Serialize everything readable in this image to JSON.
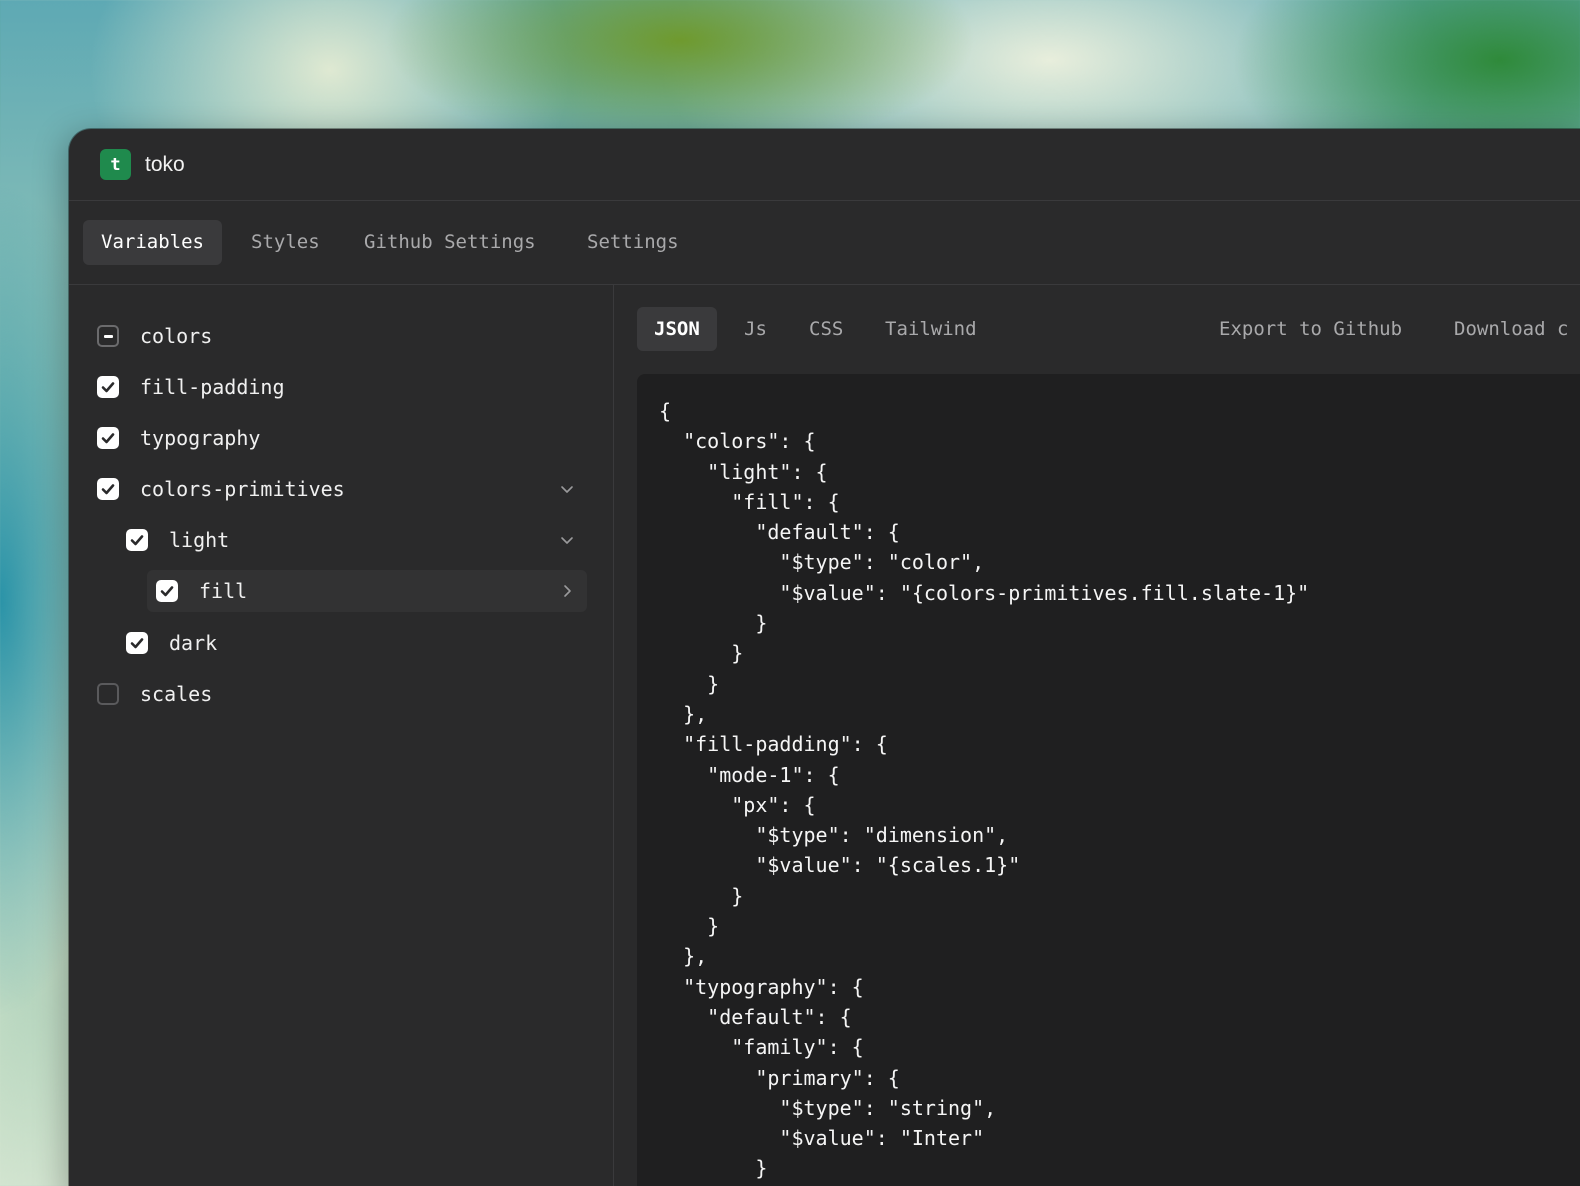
{
  "app": {
    "logo_letter": "t",
    "title": "toko",
    "accent_color": "#1f8a4d"
  },
  "nav": {
    "tabs": [
      {
        "label": "Variables",
        "active": true
      },
      {
        "label": "Styles",
        "active": false
      },
      {
        "label": "Github Settings",
        "active": false
      },
      {
        "label": "Settings",
        "active": false
      }
    ]
  },
  "tree": {
    "items": [
      {
        "label": "colors",
        "state": "indeterminate",
        "chevron": "none"
      },
      {
        "label": "fill-padding",
        "state": "checked",
        "chevron": "none"
      },
      {
        "label": "typography",
        "state": "checked",
        "chevron": "none"
      },
      {
        "label": "colors-primitives",
        "state": "checked",
        "chevron": "chevron-down-icon"
      },
      {
        "label": "light",
        "state": "checked",
        "chevron": "chevron-down-icon"
      },
      {
        "label": "fill",
        "state": "checked",
        "chevron": "chevron-right-icon",
        "selected": true
      },
      {
        "label": "dark",
        "state": "checked",
        "chevron": "none"
      },
      {
        "label": "scales",
        "state": "unchecked",
        "chevron": "none"
      }
    ]
  },
  "formats": {
    "tabs": [
      {
        "label": "JSON",
        "active": true
      },
      {
        "label": "Js",
        "active": false
      },
      {
        "label": "CSS",
        "active": false
      },
      {
        "label": "Tailwind",
        "active": false
      }
    ],
    "export_label": "Export to Github",
    "download_label": "Download c"
  },
  "code": {
    "text": "{\n  \"colors\": {\n    \"light\": {\n      \"fill\": {\n        \"default\": {\n          \"$type\": \"color\",\n          \"$value\": \"{colors-primitives.fill.slate-1}\"\n        }\n      }\n    }\n  },\n  \"fill-padding\": {\n    \"mode-1\": {\n      \"px\": {\n        \"$type\": \"dimension\",\n        \"$value\": \"{scales.1}\"\n      }\n    }\n  },\n  \"typography\": {\n    \"default\": {\n      \"family\": {\n        \"primary\": {\n          \"$type\": \"string\",\n          \"$value\": \"Inter\"\n        }"
  }
}
